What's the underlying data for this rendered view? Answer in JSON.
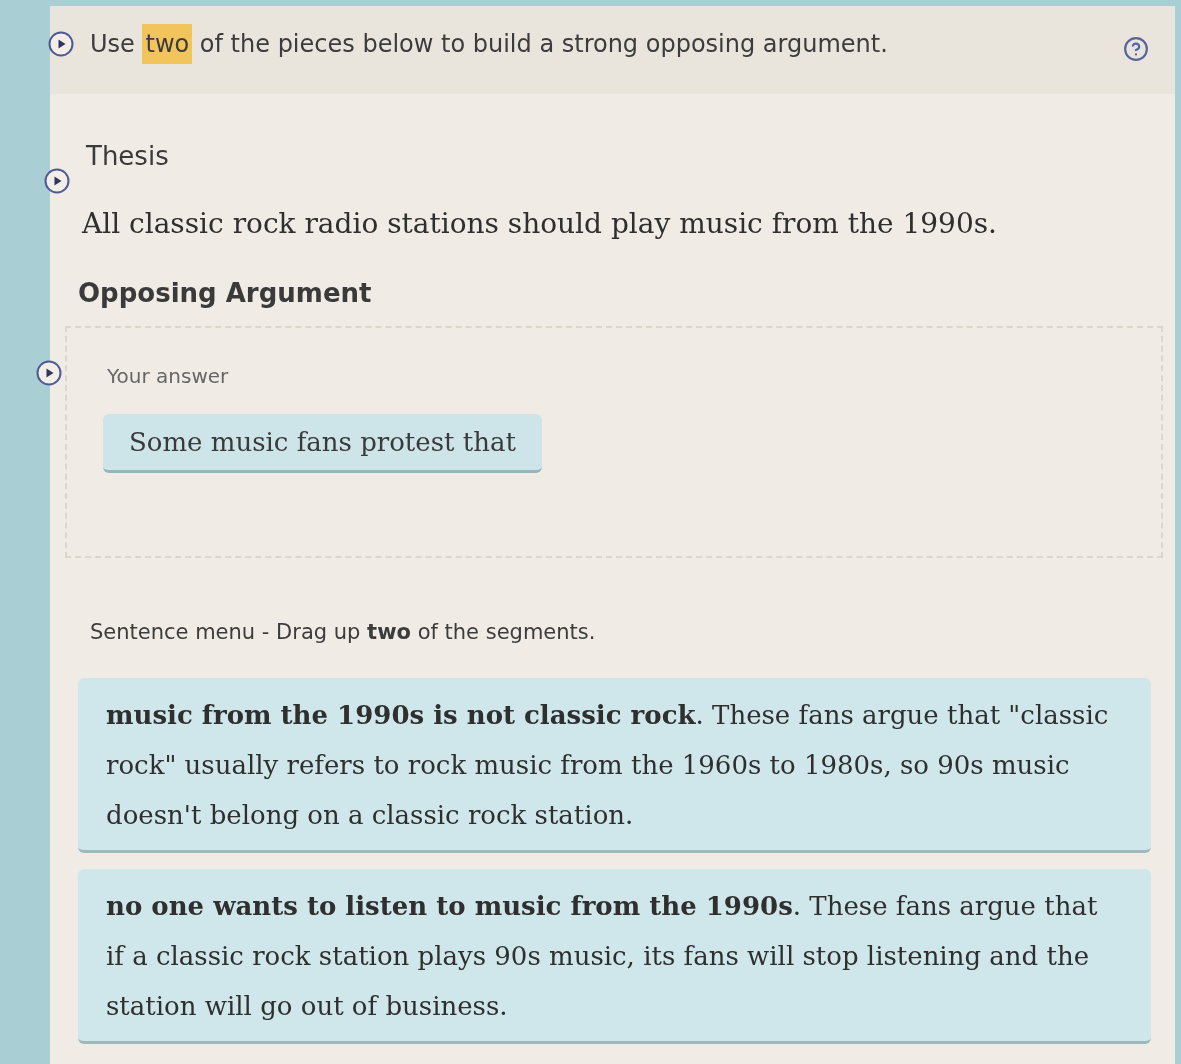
{
  "instruction": {
    "parts": [
      {
        "text": "Use",
        "highlighted": false
      },
      {
        "text": "two",
        "highlighted": true
      },
      {
        "text": "of the pieces below to build a strong opposing argument.",
        "highlighted": false
      }
    ]
  },
  "thesis": {
    "heading": "Thesis",
    "text": "All classic rock radio stations should play music from the 1990s."
  },
  "opposing_argument": {
    "heading": "Opposing Argument",
    "answer_label": "Your answer",
    "answer_pieces": [
      "Some music fans protest that"
    ]
  },
  "sentence_menu": {
    "instruction": "Sentence menu - Drag up **two** of the segments.",
    "segments": [
      "**music from the 1990s is not classic rock**. These fans argue that \"classic rock\" usually refers to rock music from the 1960s to 1980s, so 90s music doesn't belong on a classic rock station.",
      "**no one wants to listen to music from the 1990s**. These fans argue that if a classic rock station plays 90s music, its fans will stop listening and the station will go out of business."
    ]
  }
}
